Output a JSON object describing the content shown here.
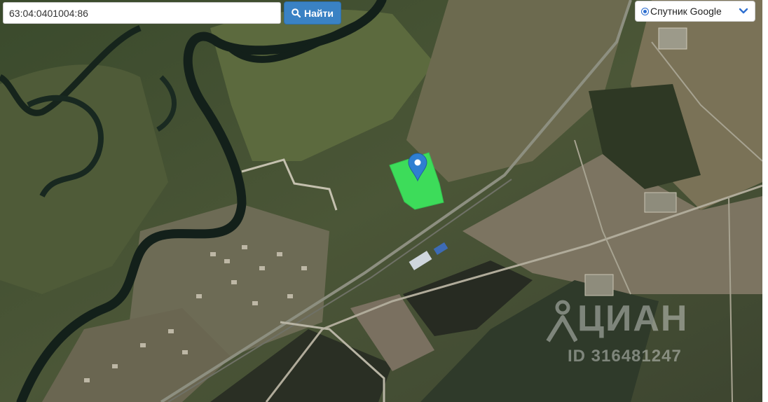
{
  "search": {
    "value": "63:04:0401004:86",
    "button_label": "Найти",
    "button_icon": "search-icon"
  },
  "layer": {
    "selected": "Спутник Google",
    "radio_checked": true,
    "dropdown_icon": "chevron-down-icon"
  },
  "map": {
    "type": "satellite",
    "marker_icon": "map-pin-icon",
    "plot_color": "#3ddc5a",
    "marker_color": "#2f7fd1"
  },
  "watermark": {
    "brand": "ЦИАН",
    "id": "ID 316481247",
    "logo_icon": "cian-logo-icon"
  },
  "colors": {
    "button": "#3a82c4",
    "accent": "#2e6fd0"
  }
}
